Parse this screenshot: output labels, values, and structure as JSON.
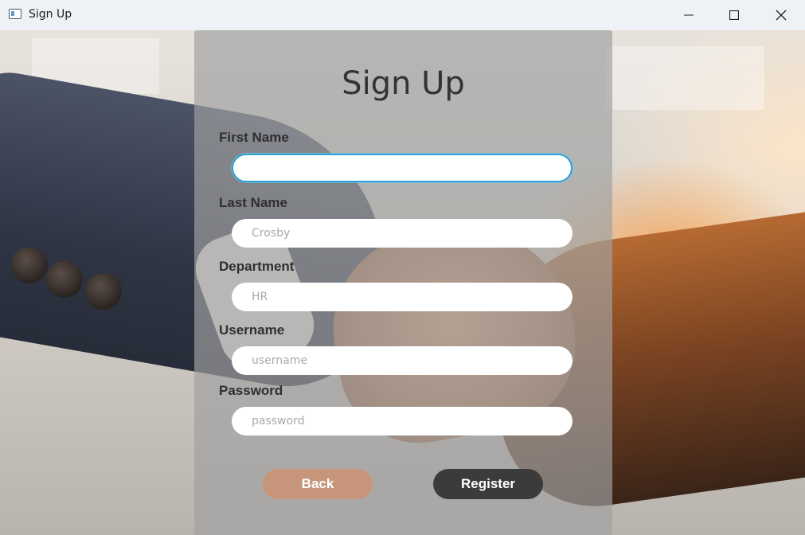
{
  "window": {
    "title": "Sign Up"
  },
  "form": {
    "heading": "Sign Up",
    "first_name": {
      "label": "First Name",
      "value": "",
      "placeholder": ""
    },
    "last_name": {
      "label": "Last Name",
      "value": "",
      "placeholder": "Crosby"
    },
    "department": {
      "label": "Department",
      "value": "",
      "placeholder": "HR"
    },
    "username": {
      "label": "Username",
      "value": "",
      "placeholder": "username"
    },
    "password": {
      "label": "Password",
      "value": "",
      "placeholder": "password"
    },
    "back_label": "Back",
    "register_label": "Register"
  },
  "colors": {
    "focus_border": "#2aa3d4",
    "back_button": "#c7967a",
    "register_button": "#3b3b3b"
  }
}
